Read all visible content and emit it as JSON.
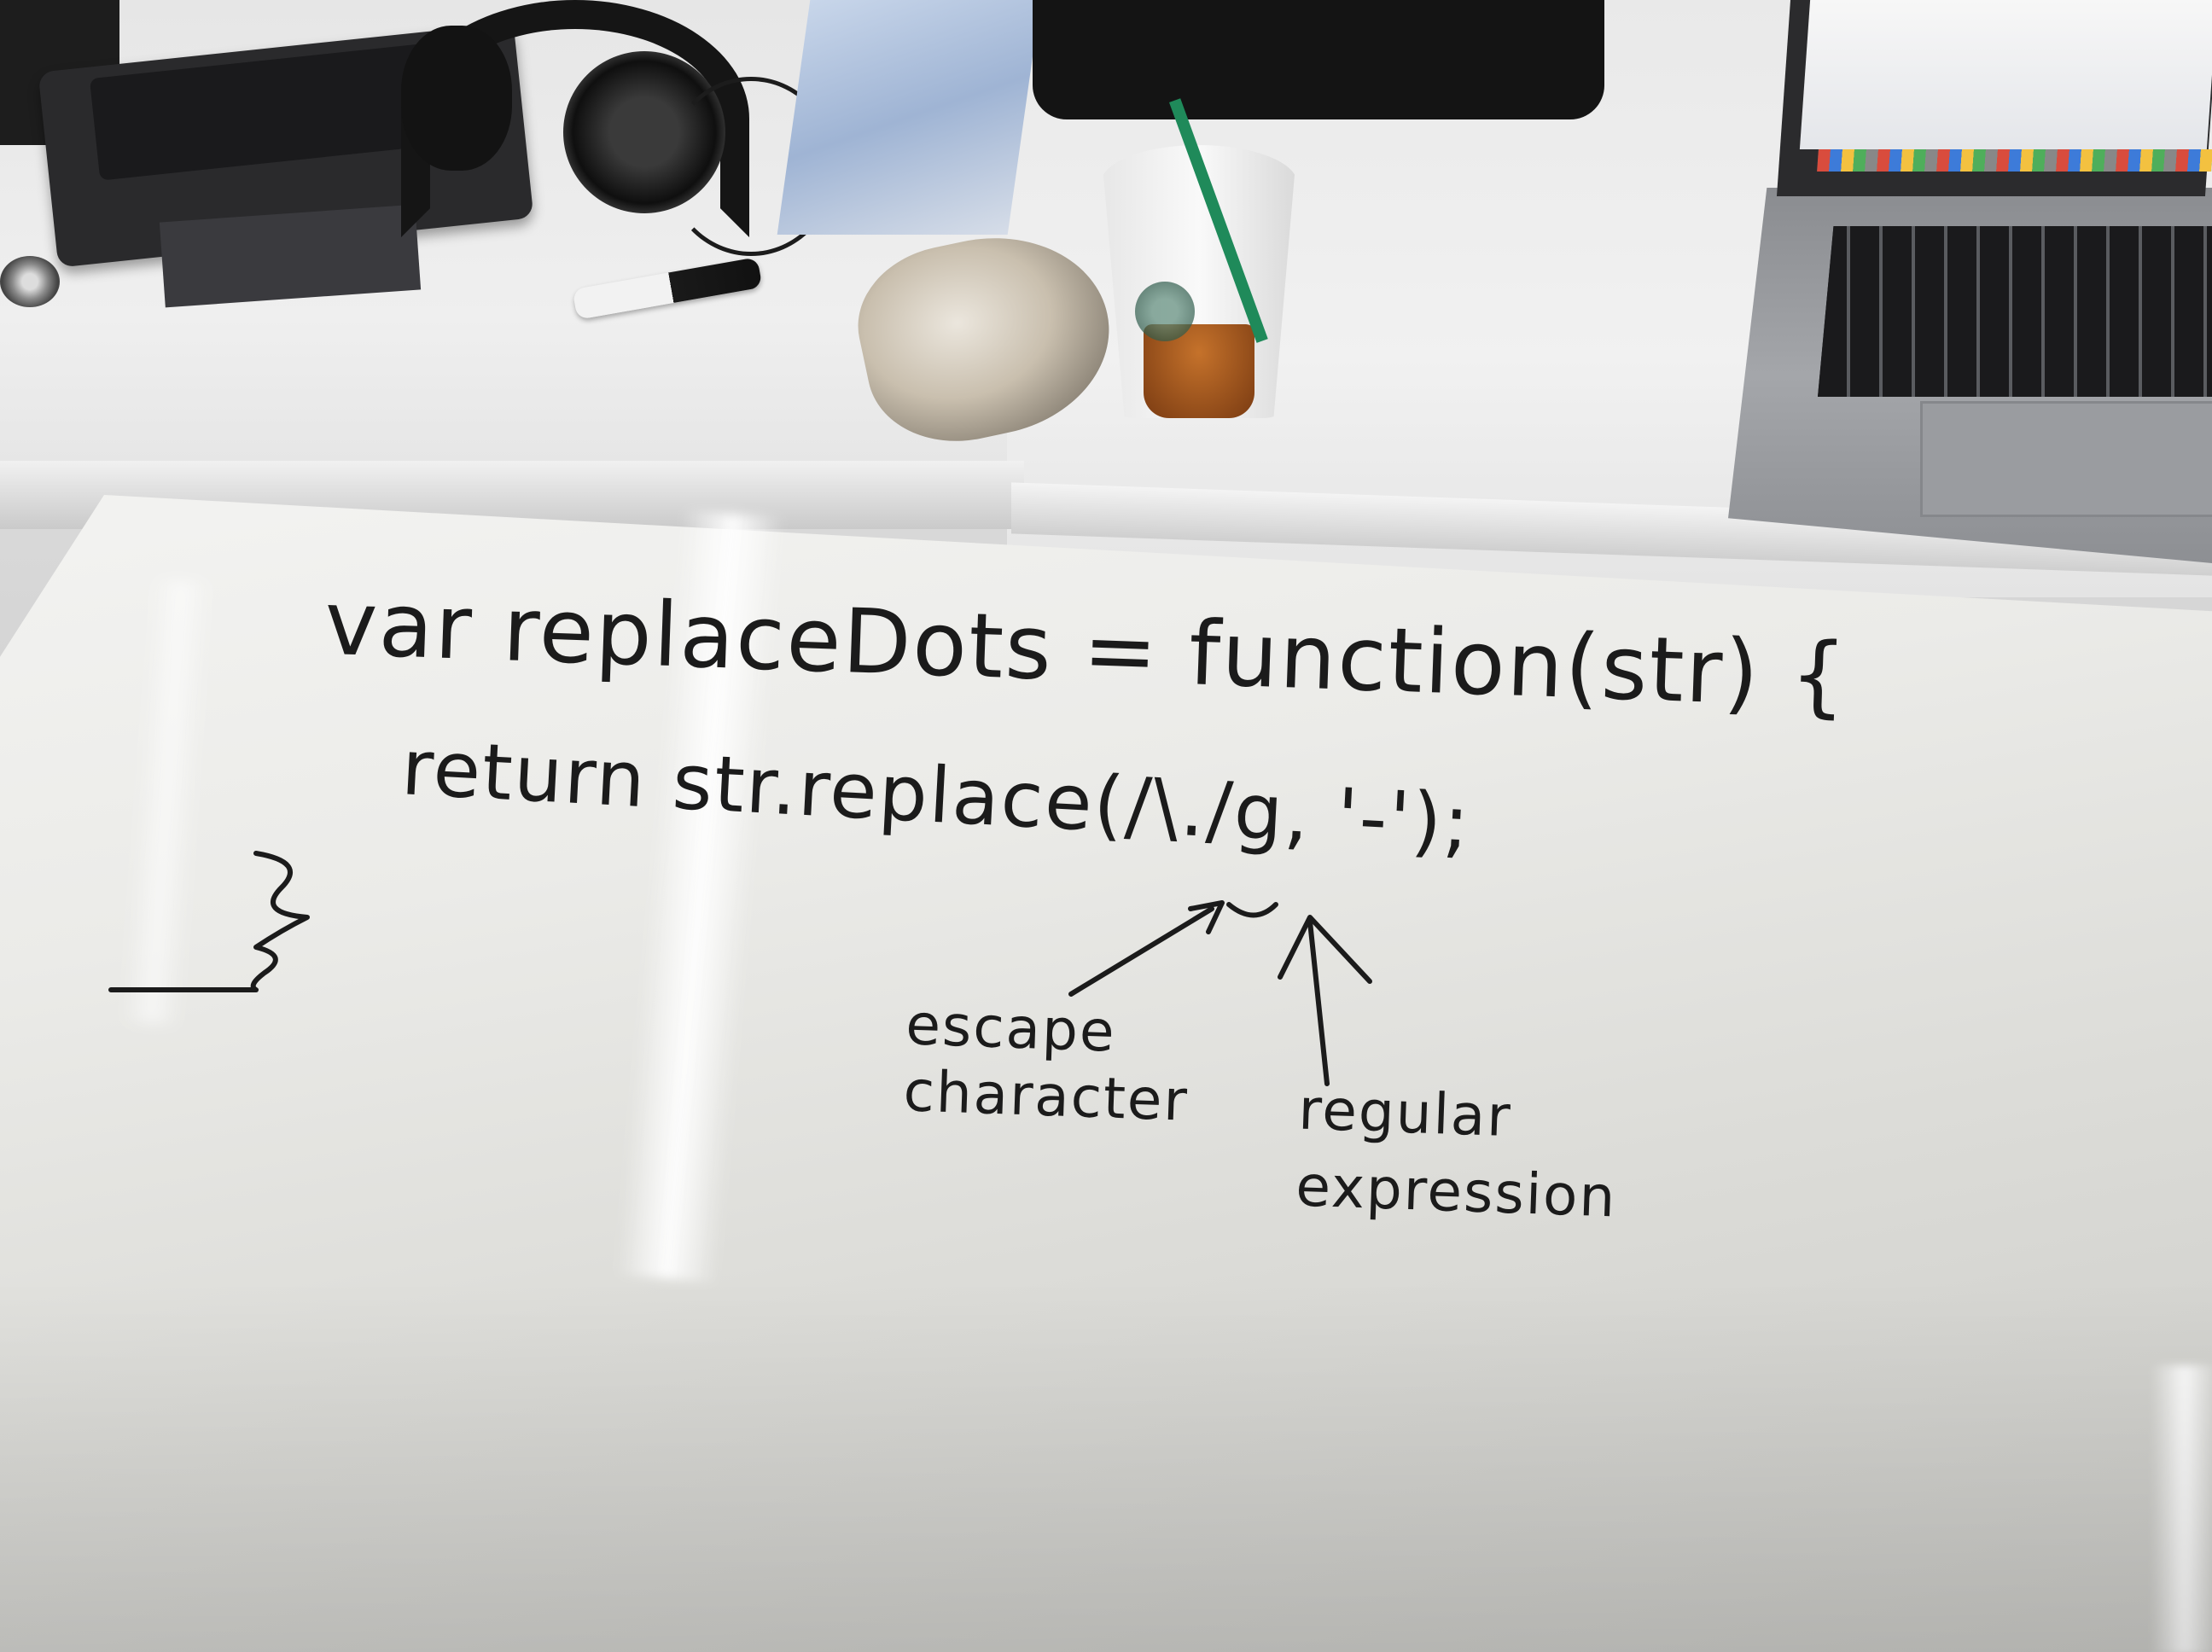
{
  "whiteboard": {
    "code_line_1": "var replaceDots = function(str) {",
    "code_line_2": "return str.replace(/\\./g, '-');",
    "code_line_3": "}",
    "annotation_escape": [
      "escape",
      "character"
    ],
    "annotation_regex": [
      "regular",
      "expression"
    ],
    "ink_color": "#1b1b1b"
  },
  "colors": {
    "whiteboard": "#ebebe8",
    "table": "#efefef",
    "straw": "#1f8a5a",
    "drink": "#a3561d",
    "laptop": "#9a9ca0"
  }
}
